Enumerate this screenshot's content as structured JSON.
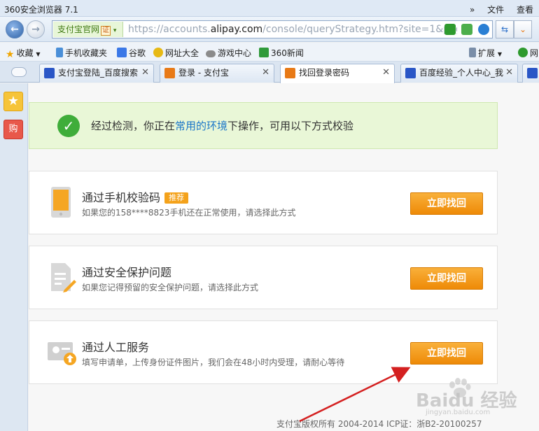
{
  "titlebar": {
    "title": "360安全浏览器 7.1",
    "chevrons": "»",
    "file_menu": "文件",
    "view_menu": "查看"
  },
  "addressbar": {
    "site_badge": "支付宝官网",
    "badge_mark": "证",
    "url_prefix": "https://accounts.",
    "url_domain": "alipay.com",
    "url_suffix": "/console/queryStrategy.htm?site=1&page_t"
  },
  "bookmarks": [
    {
      "label": "收藏",
      "icon": "star-icon"
    },
    {
      "label": "手机收藏夹",
      "icon": "phone-icon"
    },
    {
      "label": "谷歌",
      "icon": "google-icon"
    },
    {
      "label": "网址大全",
      "icon": "url-directory-icon"
    },
    {
      "label": "游戏中心",
      "icon": "gamepad-icon"
    },
    {
      "label": "360新闻",
      "icon": "news-icon"
    },
    {
      "label": "扩展",
      "icon": "extension-icon"
    },
    {
      "label": "网",
      "icon": "shield-icon"
    }
  ],
  "tabs": [
    {
      "label": "支付宝登陆_百度搜索",
      "active": false
    },
    {
      "label": "登录 - 支付宝",
      "active": false
    },
    {
      "label": "找回登录密码",
      "active": true
    },
    {
      "label": "百度经验_个人中心_我",
      "active": false
    }
  ],
  "sidebar": {
    "star": "★",
    "bag": "购"
  },
  "notice": {
    "prefix": "经过检测，你正在",
    "link": "常用的环境",
    "suffix": "下操作，可用以下方式校验"
  },
  "options": [
    {
      "title": "通过手机校验码",
      "badge": "推荐",
      "desc": "如果您的158****8823手机还在正常使用，请选择此方式",
      "button": "立即找回"
    },
    {
      "title": "通过安全保护问题",
      "desc": "如果您记得预留的安全保护问题，请选择此方式",
      "button": "立即找回"
    },
    {
      "title": "通过人工服务",
      "desc": "填写申请单，上传身份证件图片，我们会在48小时内受理，请耐心等待",
      "button": "立即找回"
    }
  ],
  "footer": "支付宝版权所有 2004-2014 ICP证：浙B2-20100257",
  "watermark": {
    "brand": "Baidu 经验",
    "sub": "jingyan.baidu.com"
  },
  "colors": {
    "accent_orange": "#ee8a07",
    "notice_green": "#3fad3a",
    "link_blue": "#1a76c8",
    "annotation_red": "#d42020"
  }
}
